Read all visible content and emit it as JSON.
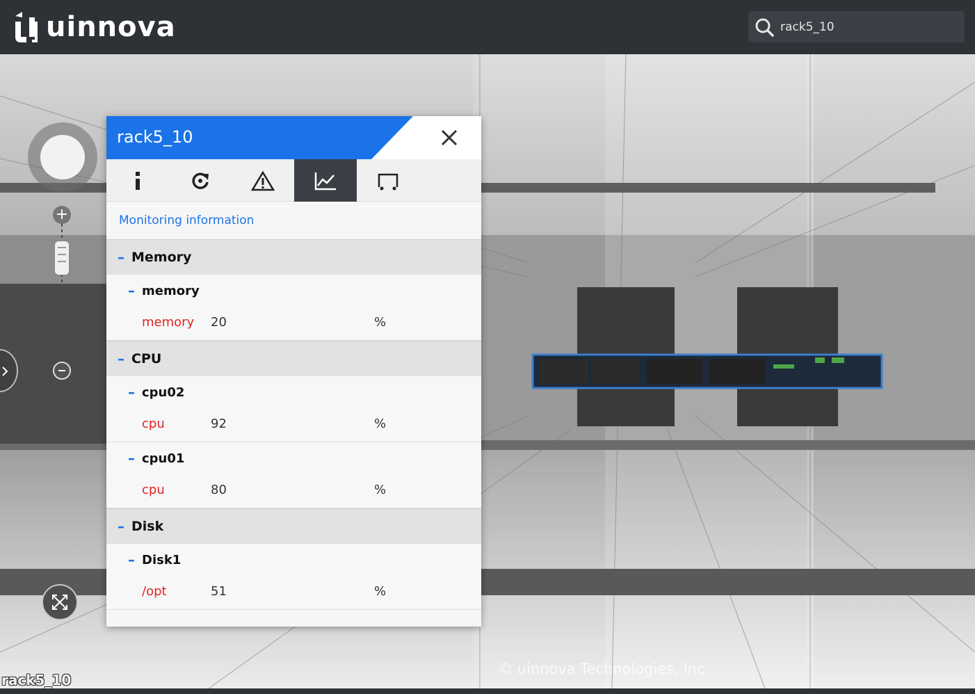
{
  "header": {
    "logo_text": "uinnova",
    "search": {
      "value": "rack5_10"
    }
  },
  "viewport": {
    "object_label": "rack5_10",
    "watermark": "© uinnova Technologies, Inc."
  },
  "panel": {
    "title": "rack5_10",
    "accent_color": "#1a73e8",
    "tabs": [
      {
        "icon": "info-icon",
        "active": false
      },
      {
        "icon": "refresh-icon",
        "active": false
      },
      {
        "icon": "warning-icon",
        "active": false
      },
      {
        "icon": "line-chart-icon",
        "active": true
      },
      {
        "icon": "port-icon",
        "active": false
      }
    ],
    "section_title": "Monitoring information",
    "groups": [
      {
        "name": "Memory",
        "subs": [
          {
            "name": "memory",
            "metrics": [
              {
                "name": "memory",
                "value": "20",
                "unit": "%"
              }
            ]
          }
        ]
      },
      {
        "name": "CPU",
        "subs": [
          {
            "name": "cpu02",
            "metrics": [
              {
                "name": "cpu",
                "value": "92",
                "unit": "%"
              }
            ]
          },
          {
            "name": "cpu01",
            "metrics": [
              {
                "name": "cpu",
                "value": "80",
                "unit": "%"
              }
            ]
          }
        ]
      },
      {
        "name": "Disk",
        "subs": [
          {
            "name": "Disk1",
            "metrics": [
              {
                "name": "/opt",
                "value": "51",
                "unit": "%"
              }
            ]
          }
        ]
      }
    ]
  }
}
